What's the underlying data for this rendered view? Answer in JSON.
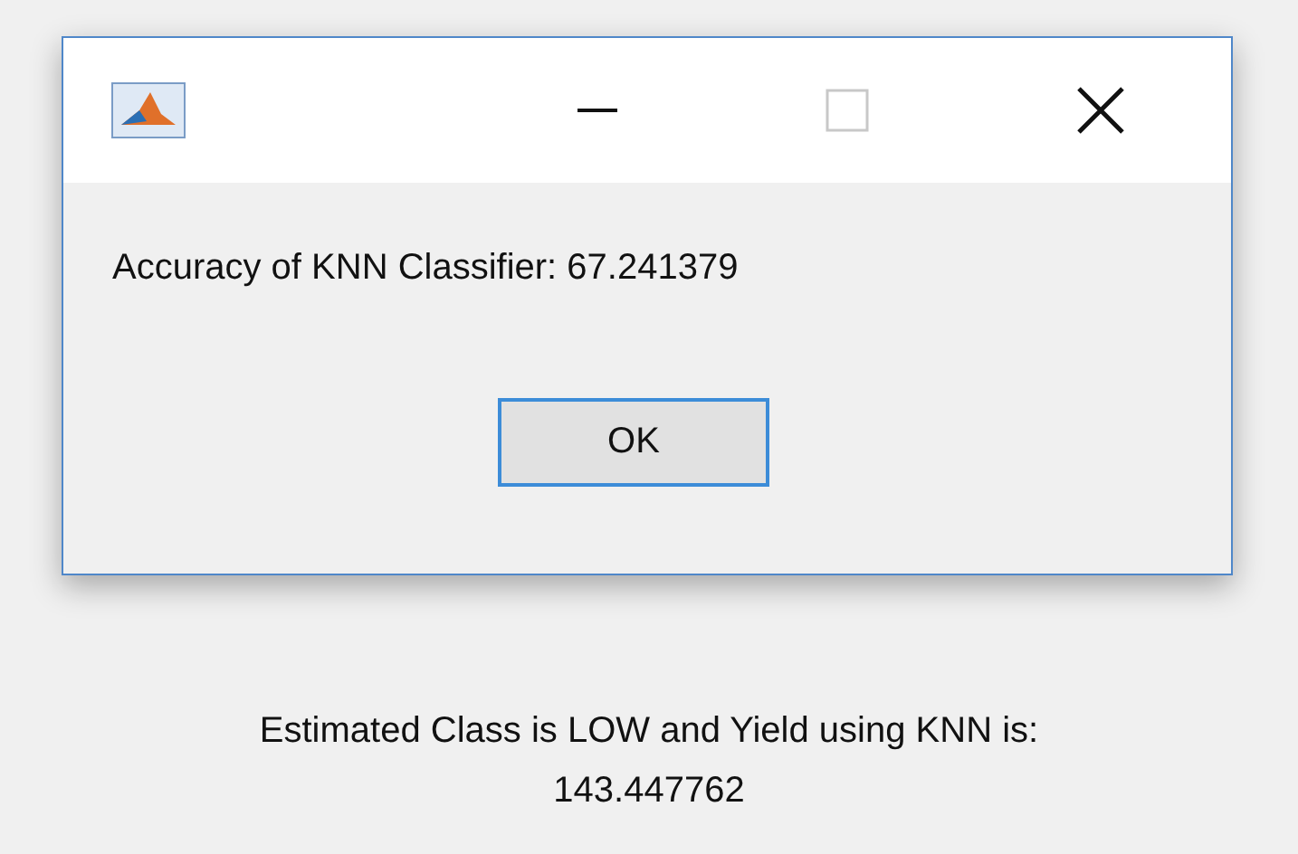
{
  "dialog": {
    "window_controls": [
      {
        "kind": "minimize",
        "disabled": false
      },
      {
        "kind": "maximize",
        "disabled": true
      },
      {
        "kind": "close",
        "disabled": false
      }
    ],
    "message": "Accuracy of KNN Classifier: 67.241379",
    "buttons": [
      {
        "label": "OK",
        "focused": true
      }
    ]
  },
  "result_lines": [
    "Estimated Class is LOW and Yield using KNN is:",
    "143.447762"
  ]
}
